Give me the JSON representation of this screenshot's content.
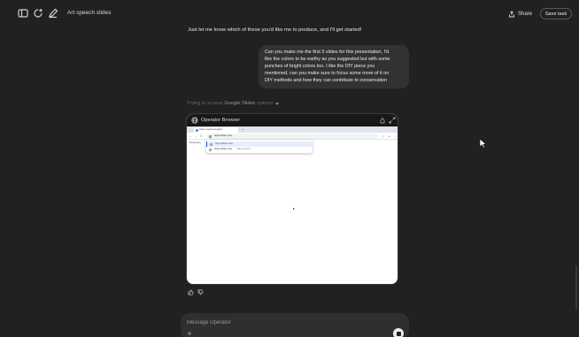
{
  "topbar": {
    "title": "Art speech slides",
    "share_label": "Share",
    "save_label": "Save task",
    "icons": [
      "sidebar-icon",
      "new-chat-icon",
      "edit-icon"
    ]
  },
  "conversation": {
    "assistant_line": "Just let me know which of these you'd like me to produce, and I'll get started!",
    "user_message_lines": [
      "Can you make me the first 3 slides for this presentation, I'd",
      "like the colors to be earthy as you suggested but with some",
      "punches of bright colors too. I like the DIY piece you",
      "mentioned, can you make sure to focus some more of it on",
      "DIY methods and how they can contribute to conservation"
    ],
    "status": {
      "prefix": "Trying to access",
      "highlight": "Google Slides",
      "suffix": "options"
    }
  },
  "browser": {
    "label": "Operator Browser",
    "tab_title": "slides.new/presentation",
    "url": "https://slides.new",
    "bookmark": "Bookmarks",
    "suggestions": [
      {
        "text": "https://slides.new",
        "sub": ""
      },
      {
        "text": "https://slides.new",
        "sub": "- Bing Search"
      }
    ],
    "cursor_glyph": "▸"
  },
  "composer": {
    "placeholder": "Message Operator"
  },
  "colors": {
    "background": "#212121",
    "bubble": "#323232",
    "composer": "#2f2f2f",
    "link_blue": "#1a56d6"
  }
}
